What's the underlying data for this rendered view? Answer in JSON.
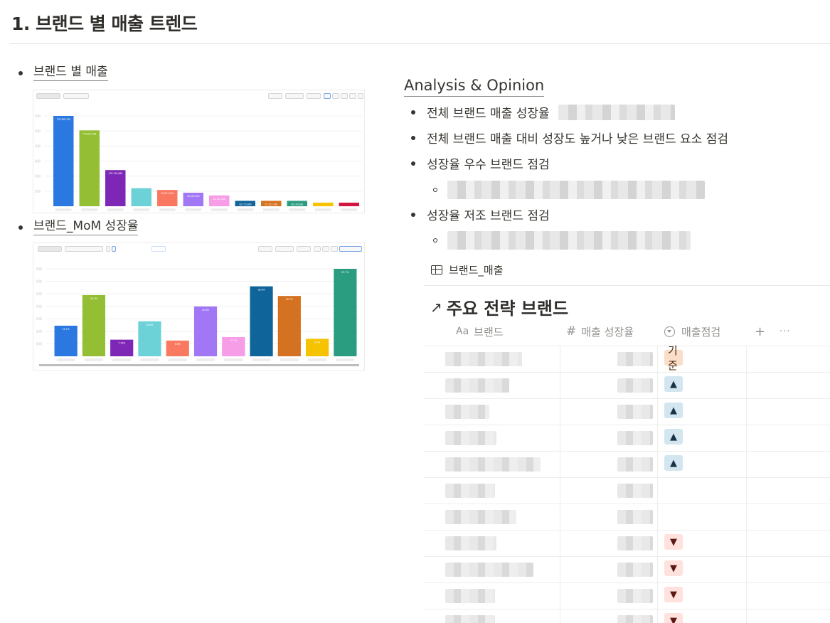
{
  "page": {
    "heading": "1. 브랜드 별 매출 트렌드"
  },
  "left": {
    "link1": "브랜드 별 매출",
    "link2": "브랜드_MoM 성장율",
    "chart1": {
      "bars": [
        {
          "color": "#2b79e0",
          "value": 100,
          "label": "776,305,793"
        },
        {
          "color": "#94bf34",
          "value": 84,
          "label": "774,617,664"
        },
        {
          "color": "#7e26b6",
          "value": 40,
          "label": "476,743,089"
        },
        {
          "color": "#6dd2d8",
          "value": 20,
          "label": ""
        },
        {
          "color": "#f97960",
          "value": 18,
          "label": "93,217,163"
        },
        {
          "color": "#a277f5",
          "value": 15,
          "label": "44,029,330"
        },
        {
          "color": "#f79ce6",
          "value": 12,
          "label": "51,123,046"
        },
        {
          "color": "#0f6499",
          "value": 6,
          "label": "33,723,860"
        },
        {
          "color": "#d57221",
          "value": 6,
          "label": "27,121,766"
        },
        {
          "color": "#2a9d81",
          "value": 6,
          "label": "26,193,681"
        },
        {
          "color": "#f5c300",
          "value": 4,
          "label": ""
        },
        {
          "color": "#d2163f",
          "value": 4,
          "label": ""
        }
      ]
    },
    "chart2": {
      "bars": [
        {
          "color": "#2b79e0",
          "value": 35,
          "label": "16.7%"
        },
        {
          "color": "#94bf34",
          "value": 70,
          "label": "35.2%"
        },
        {
          "color": "#7e26b6",
          "value": 19,
          "label": "7.16%"
        },
        {
          "color": "#6dd2d8",
          "value": 40,
          "label": "18.8%"
        },
        {
          "color": "#f97960",
          "value": 18,
          "label": "8.6%"
        },
        {
          "color": "#a277f5",
          "value": 57,
          "label": "31.8%"
        },
        {
          "color": "#f79ce6",
          "value": 22,
          "label": "10.7%"
        },
        {
          "color": "#0f6499",
          "value": 80,
          "label": "36.9%"
        },
        {
          "color": "#d57221",
          "value": 69,
          "label": "33.7%"
        },
        {
          "color": "#f5c300",
          "value": 20,
          "label": "9.6%"
        },
        {
          "color": "#2a9d81",
          "value": 100,
          "label": "57.7%"
        }
      ]
    }
  },
  "right": {
    "analysis_title": "Analysis & Opinion",
    "bullets": [
      "전체 브랜드 매출 성장율",
      "전체 브랜드 매출 대비 성장도 높거나 낮은 브랜드 요소 점검",
      "성장율 우수 브랜드 점검",
      "성장율 저조 브랜드 점검"
    ],
    "db_link": "브랜드_매출",
    "db_title": "주요 전략 브랜드",
    "db_arrow": "↗",
    "columns": {
      "brand_icon": "Aa",
      "brand": "브랜드",
      "growth_icon": "#",
      "growth": "매출 성장율",
      "check": "매출점검",
      "add": "+",
      "more": "···"
    },
    "rows": [
      {
        "tag": "기준",
        "kind": "base"
      },
      {
        "tag": "▲",
        "kind": "up"
      },
      {
        "tag": "▲",
        "kind": "up"
      },
      {
        "tag": "▲",
        "kind": "up"
      },
      {
        "tag": "▲",
        "kind": "up"
      },
      {
        "tag": "",
        "kind": "none"
      },
      {
        "tag": "",
        "kind": "none"
      },
      {
        "tag": "▼",
        "kind": "down"
      },
      {
        "tag": "▼",
        "kind": "down"
      },
      {
        "tag": "▼",
        "kind": "down"
      },
      {
        "tag": "▼",
        "kind": "down"
      }
    ]
  }
}
